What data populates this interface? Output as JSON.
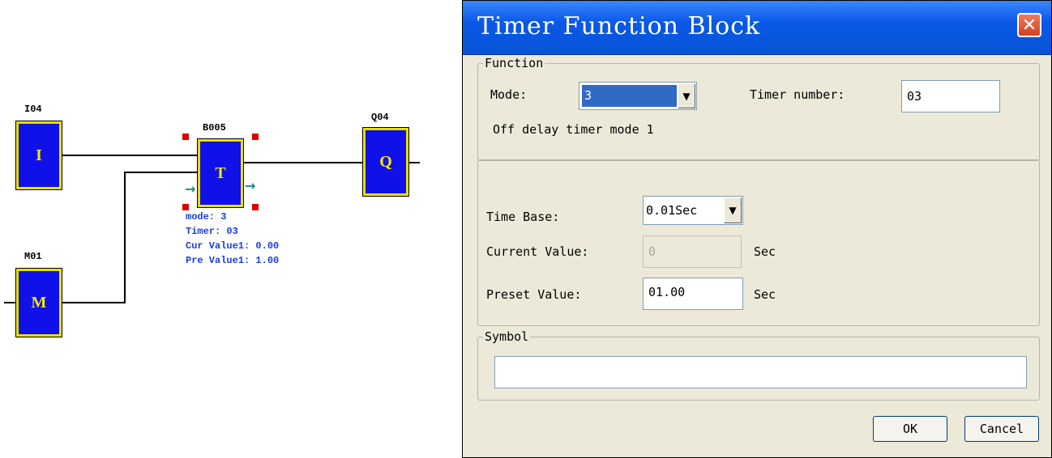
{
  "diagram": {
    "blocks": {
      "i04": {
        "name": "I04",
        "letter": "I"
      },
      "m01": {
        "name": "M01",
        "letter": "M"
      },
      "b005": {
        "name": "B005",
        "letter": "T"
      },
      "q04": {
        "name": "Q04",
        "letter": "Q"
      }
    },
    "info": {
      "mode": "mode: 3",
      "timer": "Timer: 03",
      "cur": "Cur Value1: 0.00",
      "pre": "Pre Value1: 1.00"
    },
    "colors": {
      "block_fill": "#1010e8",
      "block_border": "#e8e000",
      "info_text": "#1a3fe0",
      "handle": "#dd0000"
    }
  },
  "dialog": {
    "title": "Timer Function Block",
    "close_icon": "close-icon",
    "function_group": {
      "legend": "Function",
      "mode_label": "Mode:",
      "mode_value": "3",
      "timer_number_label": "Timer number:",
      "timer_number_value": "03",
      "description": "Off delay timer mode 1"
    },
    "time_group": {
      "time_base_label": "Time Base:",
      "time_base_value": "0.01Sec",
      "current_value_label": "Current Value:",
      "current_value": "0",
      "current_unit": "Sec",
      "preset_value_label": "Preset Value:",
      "preset_value": "01.00",
      "preset_unit": "Sec"
    },
    "symbol_group": {
      "legend": "Symbol",
      "value": ""
    },
    "buttons": {
      "ok": "OK",
      "cancel": "Cancel"
    }
  }
}
